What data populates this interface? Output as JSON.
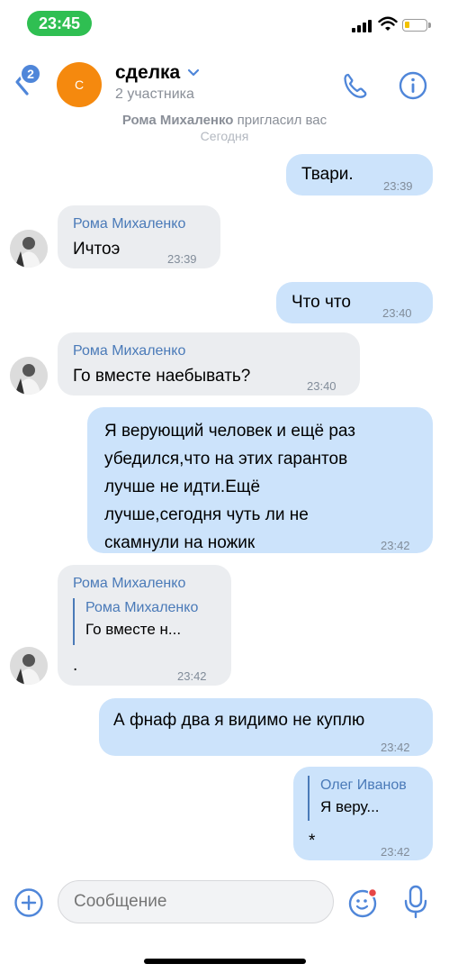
{
  "status_bar": {
    "time": "23:45"
  },
  "header": {
    "back_badge": "2",
    "avatar_letter": "С",
    "title": "сделка",
    "subtitle": "2 участника"
  },
  "system": {
    "inviter": "Рома Михаленко",
    "invite_text": " пригласил вас",
    "date": "Сегодня"
  },
  "messages": [
    {
      "dir": "out",
      "text": "Твари.",
      "time": "23:39"
    },
    {
      "dir": "in",
      "sender": "Рома Михаленко",
      "text": "Ичтоэ",
      "time": "23:39"
    },
    {
      "dir": "out",
      "text": "Что что",
      "time": "23:40"
    },
    {
      "dir": "in",
      "sender": "Рома Михаленко",
      "text": "Го вместе наебывать?",
      "time": "23:40"
    },
    {
      "dir": "out",
      "lines": [
        "Я верующий человек и ещё раз",
        "убедился,что на этих гарантов",
        "лучше не идти.Ещё",
        "лучше,сегодня чуть ли не",
        "скамнули на ножик"
      ],
      "time": "23:42"
    },
    {
      "dir": "in",
      "sender": "Рома Михаленко",
      "quote_name": "Рома Михаленко",
      "quote_text": "Го вместе н...",
      "text": ".",
      "time": "23:42"
    },
    {
      "dir": "out",
      "text": "А фнаф два я видимо не куплю",
      "time": "23:42"
    },
    {
      "dir": "out",
      "quote_name": "Олег Иванов",
      "quote_text": "Я веру...",
      "text": "*",
      "time": "23:42"
    }
  ],
  "composer": {
    "placeholder": "Сообщение"
  },
  "colors": {
    "accent": "#4f86d9",
    "outgoing_bubble": "#cce3fb",
    "incoming_bubble": "#ebedf0",
    "avatar": "#f5890e",
    "time_pill": "#2fbf52"
  },
  "icons": [
    "back-chevron-icon",
    "phone-icon",
    "info-icon",
    "plus-circle-icon",
    "sticker-smile-icon",
    "microphone-icon",
    "wifi-icon",
    "signal-icon",
    "battery-icon"
  ]
}
